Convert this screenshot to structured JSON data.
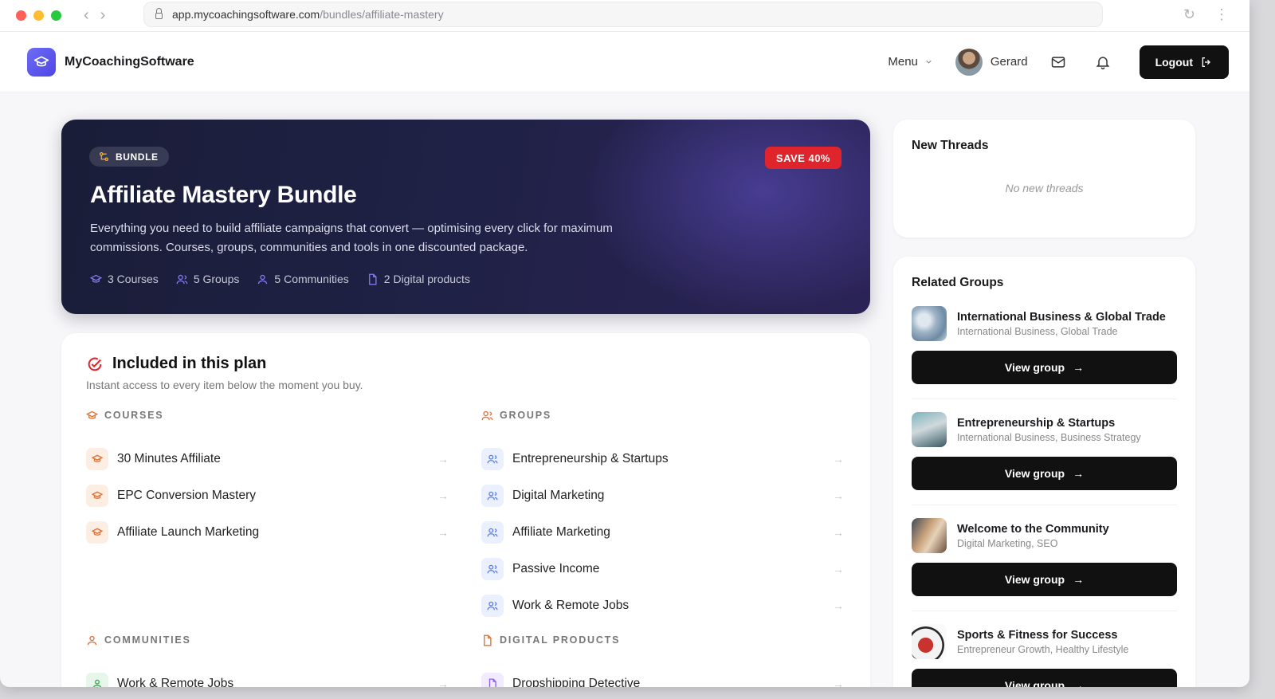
{
  "browser": {
    "url_host": "app.mycoachingsoftware.com",
    "url_path": "/bundles/affiliate-mastery"
  },
  "header": {
    "brand": "MyCoachingSoftware",
    "menu_label": "Menu",
    "user_name": "Gerard",
    "logout_label": "Logout"
  },
  "hero": {
    "badge": "BUNDLE",
    "save_badge": "SAVE 40%",
    "title": "Affiliate Mastery Bundle",
    "description": "Everything you need to build affiliate campaigns that convert — optimising every click for maximum commissions. Courses, groups, communities and tools in one discounted package.",
    "stats": {
      "courses": "3 Courses",
      "groups": "5 Groups",
      "communities": "5 Communities",
      "products": "2 Digital products"
    }
  },
  "included": {
    "title": "Included in this plan",
    "subtitle": "Instant access to every item below the moment you buy.",
    "courses": {
      "heading": "COURSES",
      "items": [
        "30 Minutes Affiliate",
        "EPC Conversion Mastery",
        "Affiliate Launch Marketing"
      ]
    },
    "groups": {
      "heading": "GROUPS",
      "items": [
        "Entrepreneurship & Startups",
        "Digital Marketing",
        "Affiliate Marketing",
        "Passive Income",
        "Work & Remote Jobs"
      ]
    },
    "communities": {
      "heading": "COMMUNITIES",
      "items": [
        "Work & Remote Jobs"
      ]
    },
    "products": {
      "heading": "DIGITAL PRODUCTS",
      "items": [
        "Dropshipping Detective"
      ]
    }
  },
  "threads": {
    "title": "New Threads",
    "empty": "No new threads"
  },
  "related": {
    "title": "Related Groups",
    "button_label": "View group",
    "groups": [
      {
        "name": "International Business & Global Trade",
        "tags": "International Business, Global Trade"
      },
      {
        "name": "Entrepreneurship & Startups",
        "tags": "International Business, Business Strategy"
      },
      {
        "name": "Welcome to the Community",
        "tags": "Digital Marketing, SEO"
      },
      {
        "name": "Sports & Fitness for Success",
        "tags": "Entrepreneur Growth, Healthy Lifestyle"
      }
    ]
  },
  "colors": {
    "accent": "#4f46e5",
    "save_red": "#e0242b",
    "course_orange": "#e2743a",
    "group_blue": "#5a7be6",
    "community_green": "#3fae5a",
    "product_purple": "#8a5cf0"
  }
}
